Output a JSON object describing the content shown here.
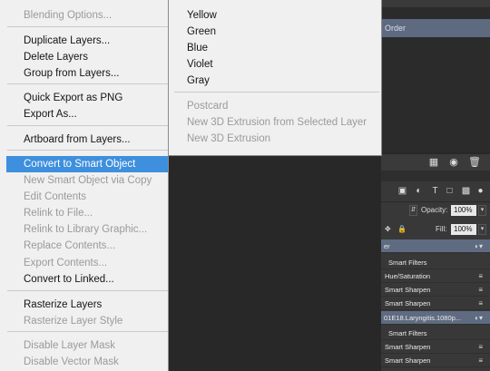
{
  "context_menu": {
    "items": [
      {
        "label": "Blending Options...",
        "disabled": true
      },
      {
        "label": "Duplicate Layers...",
        "disabled": false
      },
      {
        "label": "Delete Layers",
        "disabled": false
      },
      {
        "label": "Group from Layers...",
        "disabled": false
      },
      {
        "label": "Quick Export as PNG",
        "disabled": false
      },
      {
        "label": "Export As...",
        "disabled": false
      },
      {
        "label": "Artboard from Layers...",
        "disabled": false
      },
      {
        "label": "Convert to Smart Object",
        "disabled": false,
        "highlighted": true
      },
      {
        "label": "New Smart Object via Copy",
        "disabled": true
      },
      {
        "label": "Edit Contents",
        "disabled": true
      },
      {
        "label": "Relink to File...",
        "disabled": true
      },
      {
        "label": "Relink to Library Graphic...",
        "disabled": true
      },
      {
        "label": "Replace Contents...",
        "disabled": true
      },
      {
        "label": "Export Contents...",
        "disabled": true
      },
      {
        "label": "Convert to Linked...",
        "disabled": false
      },
      {
        "label": "Rasterize Layers",
        "disabled": false
      },
      {
        "label": "Rasterize Layer Style",
        "disabled": true
      },
      {
        "label": "Disable Layer Mask",
        "disabled": true
      },
      {
        "label": "Disable Vector Mask",
        "disabled": true
      }
    ]
  },
  "submenu": {
    "items": [
      {
        "label": "Yellow",
        "disabled": false
      },
      {
        "label": "Green",
        "disabled": false
      },
      {
        "label": "Blue",
        "disabled": false
      },
      {
        "label": "Violet",
        "disabled": false
      },
      {
        "label": "Gray",
        "disabled": false
      },
      {
        "label": "Postcard",
        "disabled": true
      },
      {
        "label": "New 3D Extrusion from Selected Layer",
        "disabled": true
      },
      {
        "label": "New 3D Extrusion",
        "disabled": true
      }
    ]
  },
  "top_panel": {
    "selected_row_label": "Order"
  },
  "layers_panel": {
    "opacity_label": "Opacity:",
    "opacity_value": "100%",
    "fill_label": "Fill:",
    "fill_value": "100%",
    "rows": [
      {
        "label": "er",
        "type": "layer-selected"
      },
      {
        "label": "Smart Filters",
        "type": "filters-header"
      },
      {
        "label": "Hue/Saturation",
        "type": "filter"
      },
      {
        "label": "Smart Sharpen",
        "type": "filter"
      },
      {
        "label": "Smart Sharpen",
        "type": "filter"
      },
      {
        "label": "01E18.Laryngitis.1080p...",
        "type": "layer-selected"
      },
      {
        "label": "Smart Filters",
        "type": "filters-header"
      },
      {
        "label": "Smart Sharpen",
        "type": "filter"
      },
      {
        "label": "Smart Sharpen",
        "type": "filter"
      }
    ]
  },
  "colors": {
    "menu_background": "#f0f0f0",
    "menu_highlight": "#3e8fdd",
    "menu_disabled_text": "#9a9a9a",
    "panel_background": "#383838",
    "selected_layer": "#5f6b80"
  }
}
